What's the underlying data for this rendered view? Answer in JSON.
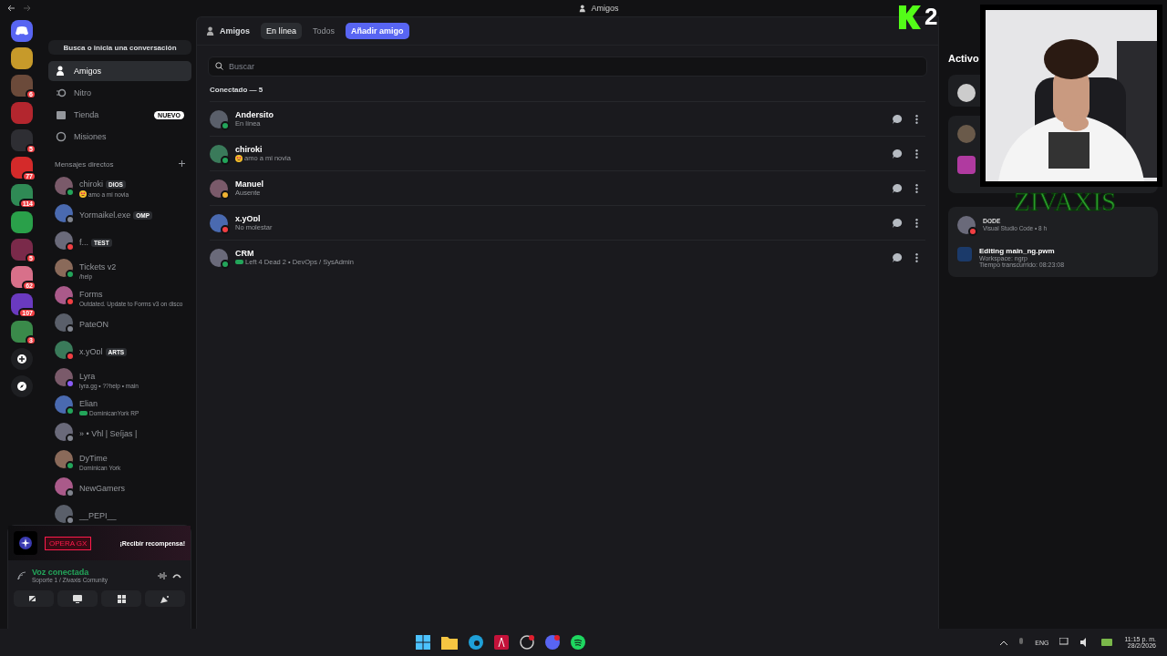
{
  "window": {
    "title": "Amigos"
  },
  "servers": [
    {
      "color": "#c79a2a"
    },
    {
      "color": "#6b4a3a",
      "badge": "6"
    },
    {
      "color": "#b3262e"
    },
    {
      "color": "#2e2e33",
      "badge": "5"
    },
    {
      "color": "#d42a2a",
      "badge": "77"
    },
    {
      "color": "#2f8a55",
      "badge": "114"
    },
    {
      "color": "#2aa04a"
    },
    {
      "color": "#7a2a4a",
      "badge": "5"
    },
    {
      "color": "#d8708a",
      "badge": "62"
    },
    {
      "color": "#6a3ac0",
      "badge": "107"
    },
    {
      "color": "#3a8a4a",
      "badge": "3"
    }
  ],
  "search_conversation": "Busca o inicia una conversación",
  "nav": [
    {
      "label": "Amigos",
      "kind": "friends",
      "selected": true
    },
    {
      "label": "Nitro",
      "kind": "nitro",
      "selected": false
    },
    {
      "label": "Tienda",
      "kind": "shop",
      "selected": false,
      "badge": "NUEVO"
    },
    {
      "label": "Misiones",
      "kind": "quests",
      "selected": false
    }
  ],
  "dm_header": "Mensajes directos",
  "dms": [
    {
      "name": "chiroki",
      "tag": "DIOS",
      "sub": "amo a mi novia",
      "kind": "emoji",
      "color": "#23a55a"
    },
    {
      "name": "Yormaikel.exe",
      "tag": "OMP",
      "color": "#80848e"
    },
    {
      "name": "f...",
      "tag": "TEST",
      "color": "#f23f43"
    },
    {
      "name": "Tickets v2",
      "sub": "/help",
      "color": "#23a55a"
    },
    {
      "name": "Forms",
      "sub": "Outdated. Update to Forms v3 on disco",
      "color": "#f23f43"
    },
    {
      "name": "PateON",
      "color": "#80848e"
    },
    {
      "name": "x.yOɒl",
      "tag": "ARTS",
      "color": "#f23f43"
    },
    {
      "name": "Lyra",
      "sub": "lyra.gg • ??help • main",
      "color": "#8a5cf6"
    },
    {
      "name": "Elian",
      "sub": "DominicanYork RP",
      "kind": "game",
      "color": "#23a55a"
    },
    {
      "name": "» • Vhl | Seíjas |",
      "color": "#80848e"
    },
    {
      "name": "DyTime",
      "sub": "Dominican York",
      "color": "#23a55a"
    },
    {
      "name": "NewGamers",
      "color": "#80848e"
    },
    {
      "name": "__PEPI__",
      "color": "#80848e"
    }
  ],
  "promo": {
    "logo": "OPERA GX",
    "action": "¡Recibir recompensa!"
  },
  "voice": {
    "title": "Voz conectada",
    "channel": "Soporte 1 / Zivaxis Comunity"
  },
  "tabs": [
    {
      "label": "En línea",
      "selected": true
    },
    {
      "label": "Todos",
      "selected": false
    }
  ],
  "add_friend": "Añadir amigo",
  "header_label": "Amigos",
  "search": {
    "placeholder": "Buscar"
  },
  "section": "Conectado — 5",
  "friends": [
    {
      "name": "Andersito",
      "sub": "En línea",
      "color": "#23a55a"
    },
    {
      "name": "chiroki",
      "sub": "amo a mi novia",
      "kind": "emoji",
      "color": "#23a55a"
    },
    {
      "name": "Manuel",
      "sub": "Ausente",
      "color": "#f0b232"
    },
    {
      "name": "x.yOɒl",
      "sub": "No molestar",
      "color": "#f23f43"
    },
    {
      "name": "CRM",
      "sub": "Left 4 Dead 2 • DevOps / SysAdmin",
      "kind": "game",
      "color": "#23a55a"
    }
  ],
  "activity": {
    "title": "Activo",
    "user": {
      "name": "ᴅᴏᴅᴇ",
      "color": "#f23f43"
    },
    "user_sub": "Visual Studio Code • 8 h",
    "detail": "Editing main_ng.pwm",
    "lines": [
      "Workspace: ngrp",
      "Tiempo transcurrido: 08:23:08"
    ]
  },
  "overlay": {
    "logo": "2",
    "name": "ZIVAXIS"
  },
  "taskbar": {
    "language": "ENG",
    "time": "11:15 p. m.",
    "date": "28/2/2026"
  }
}
